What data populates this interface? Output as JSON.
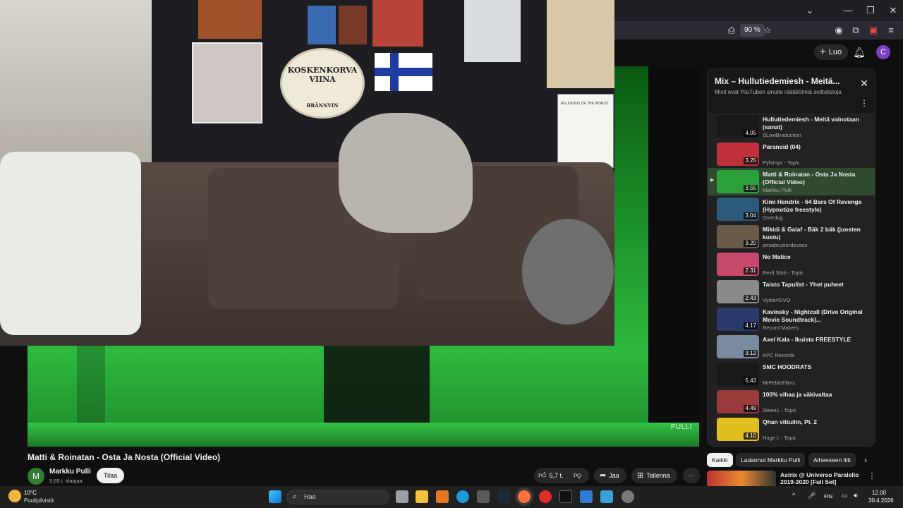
{
  "browser": {
    "zoom": "90 %",
    "window_controls": [
      "⌄",
      "—",
      "❐",
      "✕"
    ]
  },
  "yt_header": {
    "create_label": "Luo",
    "avatar_letter": "C"
  },
  "player": {
    "watermark": "PULLI",
    "overlay_sign": "KOSKENKORVA VIINA",
    "overlay_sign_sub": "BRÄNNVIN",
    "overlay_paper_title": "RELIGIONS OF THE WORLD"
  },
  "playlist": {
    "title": "Mix – Hullutiedemiesh - Meitä...",
    "subtitle": "Mixit ovat YouTuben sinulle räätälöimiä soittolistoja",
    "items": [
      {
        "title": "Hullutiedemiesh - Meitä vainotaan (sanat)",
        "channel": "SLowBroduction",
        "duration": "4.05",
        "active": false,
        "thumb": "#1a1a1a"
      },
      {
        "title": "Paranoid (04)",
        "channel": "Pyhimys - Topic",
        "duration": "3.25",
        "active": false,
        "thumb": "#c0303a"
      },
      {
        "title": "Matti & Roinatan - Osta Ja Nosta (Official Video)",
        "channel": "Markku Pulli",
        "duration": "3.55",
        "active": true,
        "thumb": "#2aa13a"
      },
      {
        "title": "Kimi Hendrix - 64 Bars Of Revenge (Hypnotize freestyle)",
        "channel": "Överdog",
        "duration": "3.04",
        "active": false,
        "thumb": "#2d5a7a"
      },
      {
        "title": "Mikidi & Gaiaf - Bäk 2 bäk (juosten kustu)",
        "channel": "amadeuslordevaux",
        "duration": "3.20",
        "active": false,
        "thumb": "#6a5a4a"
      },
      {
        "title": "No Malice",
        "channel": "Eevil Stöö - Topic",
        "duration": "2.31",
        "active": false,
        "thumb": "#c84a6a"
      },
      {
        "title": "Taisto Tapulist - Yhet puheet",
        "channel": "VydiaVEVO",
        "duration": "2.43",
        "active": false,
        "thumb": "#8a8a8a"
      },
      {
        "title": "Kavinsky - Nightcall (Drive Original Movie Soundtrack)...",
        "channel": "Record Makers",
        "duration": "4.17",
        "active": false,
        "thumb": "#2a3a6a"
      },
      {
        "title": "Axel Kala - Ikuista FREESTYLE",
        "channel": "KPC Records",
        "duration": "3.12",
        "active": false,
        "thumb": "#7a8aa0"
      },
      {
        "title": "SMC HOODRATS",
        "channel": "MrPebloFilms",
        "duration": "5.43",
        "active": false,
        "thumb": "#1a1a1a"
      },
      {
        "title": "100% vihaa ja väkivaltaa",
        "channel": "Steen1 - Topic",
        "duration": "4.49",
        "active": false,
        "thumb": "#9a3a3a"
      },
      {
        "title": "Qhan vittuilin, Pt. 2",
        "channel": "Huge L - Topic",
        "duration": "4.10",
        "active": false,
        "thumb": "#e0c020"
      }
    ]
  },
  "video": {
    "title": "Matti & Roinatan - Osta Ja Nosta (Official Video)",
    "channel": "Markku Pulli",
    "channel_avatar": "M",
    "subscribers": "9,65 t. tilaajaa",
    "subscribe_label": "Tilaa",
    "likes": "5,7 t.",
    "share_label": "Jaa",
    "save_label": "Tallenna",
    "more_label": "···"
  },
  "chips": {
    "items": [
      "Kaikki",
      "Ladannut Markku Pulli",
      "Aiheeseen liitt"
    ]
  },
  "recommendation": {
    "title": "Astrix @ Universo Paralello 2019-2020 [Full Set]"
  },
  "taskbar": {
    "temperature": "10°C",
    "weather": "Puolipilvistä",
    "search_placeholder": "Hae",
    "language": "FIN",
    "time": "12.00",
    "date": "30.4.2026"
  },
  "colors": {
    "accent": "#f1f1f1",
    "active_row": "#2f4a2f",
    "screen_green": "#2db83e"
  }
}
